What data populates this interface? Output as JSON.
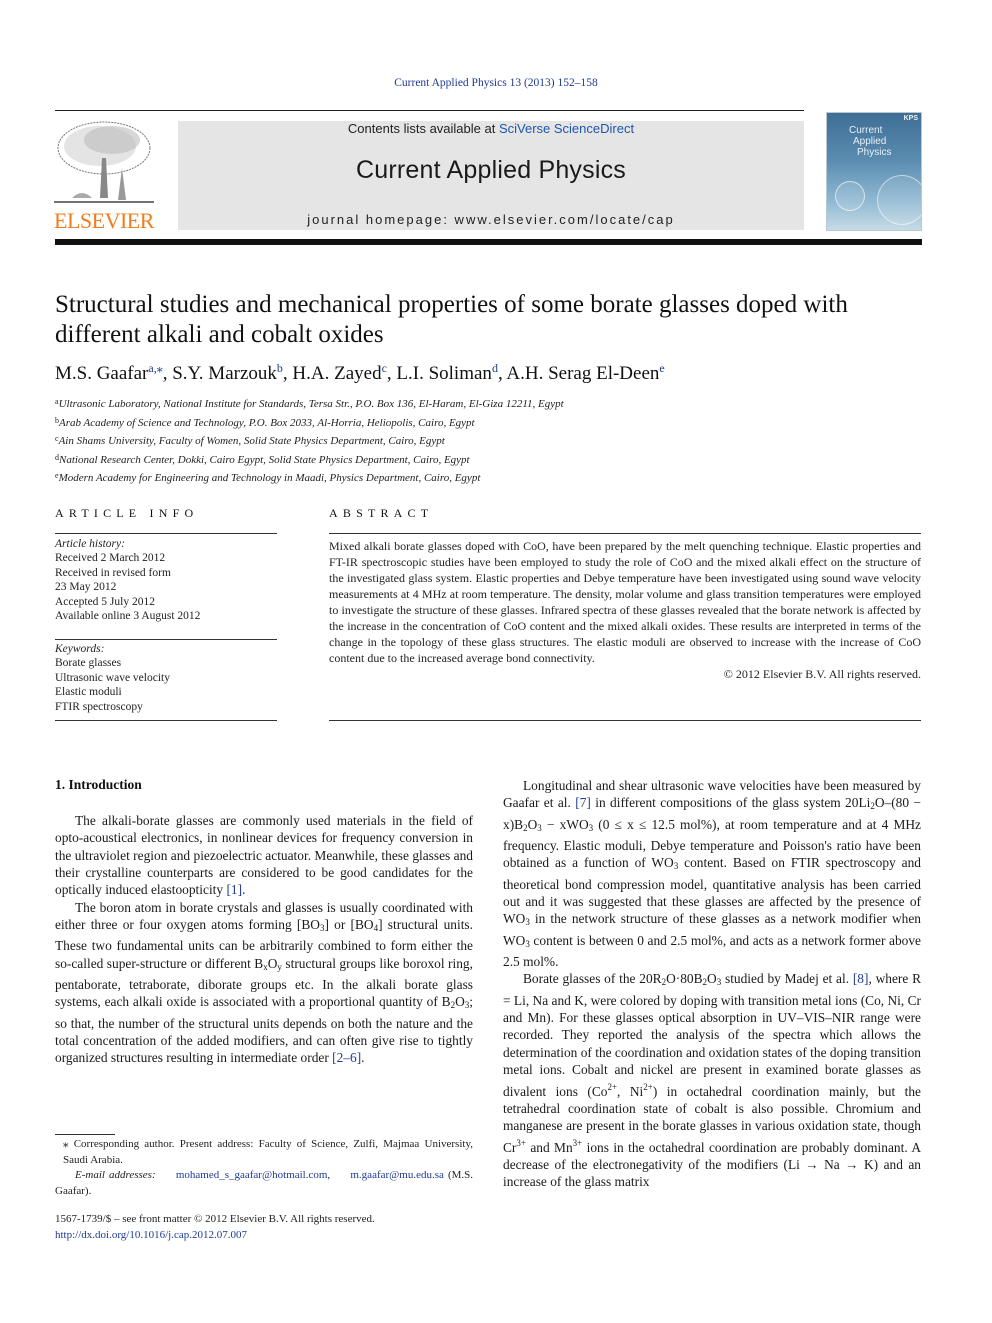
{
  "running_head": "Current Applied Physics 13 (2013) 152–158",
  "masthead": {
    "publisher": "ELSEVIER",
    "contents_prefix": "Contents lists available at ",
    "contents_link": "SciVerse ScienceDirect",
    "journal_name": "Current Applied Physics",
    "homepage": "journal homepage: www.elsevier.com/locate/cap",
    "cover_title_lines": [
      "Current",
      "Applied",
      "Physics"
    ],
    "cover_badge": "KPS",
    "colors": {
      "publisher_orange": "#f07d1c",
      "link_blue": "#1f3a93",
      "masthead_grey": "#e5e5e5"
    }
  },
  "article": {
    "title": "Structural studies and mechanical properties of some borate glasses doped with different alkali and cobalt oxides",
    "authors": [
      {
        "name": "M.S. Gaafar",
        "sup": "a,⁎"
      },
      {
        "name": "S.Y. Marzouk",
        "sup": "b"
      },
      {
        "name": "H.A. Zayed",
        "sup": "c"
      },
      {
        "name": "L.I. Soliman",
        "sup": "d"
      },
      {
        "name": "A.H. Serag El-Deen",
        "sup": "e"
      }
    ],
    "affiliations": [
      {
        "key": "a",
        "text": "Ultrasonic Laboratory, National Institute for Standards, Tersa Str., P.O. Box 136, El-Haram, El-Giza 12211, Egypt"
      },
      {
        "key": "b",
        "text": "Arab Academy of Science and Technology, P.O. Box 2033, Al-Horria, Heliopolis, Cairo, Egypt"
      },
      {
        "key": "c",
        "text": "Ain Shams University, Faculty of Women, Solid State Physics Department, Cairo, Egypt"
      },
      {
        "key": "d",
        "text": "National Research Center, Dokki, Cairo Egypt, Solid State Physics Department, Cairo, Egypt"
      },
      {
        "key": "e",
        "text": "Modern Academy for Engineering and Technology in Maadi, Physics Department, Cairo, Egypt"
      }
    ]
  },
  "article_info": {
    "heading": "ARTICLE INFO",
    "history_label": "Article history:",
    "history": [
      "Received 2 March 2012",
      "Received in revised form",
      "23 May 2012",
      "Accepted 5 July 2012",
      "Available online 3 August 2012"
    ],
    "keywords_label": "Keywords:",
    "keywords": [
      "Borate glasses",
      "Ultrasonic wave velocity",
      "Elastic moduli",
      "FTIR spectroscopy"
    ]
  },
  "abstract": {
    "heading": "ABSTRACT",
    "text": "Mixed alkali borate glasses doped with CoO, have been prepared by the melt quenching technique. Elastic properties and FT-IR spectroscopic studies have been employed to study the role of CoO and the mixed alkali effect on the structure of the investigated glass system. Elastic properties and Debye temperature have been investigated using sound wave velocity measurements at 4 MHz at room temperature. The density, molar volume and glass transition temperatures were employed to investigate the structure of these glasses. Infrared spectra of these glasses revealed that the borate network is affected by the increase in the concentration of CoO content and the mixed alkali oxides. These results are interpreted in terms of the change in the topology of these glass structures. The elastic moduli are observed to increase with the increase of CoO content due to the increased average bond connectivity.",
    "copyright": "© 2012 Elsevier B.V. All rights reserved."
  },
  "body": {
    "section_heading": "1.  Introduction",
    "left": {
      "p1": "The alkali-borate glasses are commonly used materials in the field of opto-acoustical electronics, in nonlinear devices for frequency conversion in the ultraviolet region and piezoelectric actuator. Meanwhile, these glasses and their crystalline counterparts are considered to be good candidates for the optically induced elastoopticity ",
      "p1_ref": "[1]",
      "p2_a": "The boron atom in borate crystals and glasses is usually coordinated with either three or four oxygen atoms forming [BO",
      "p2_b": "] or [BO",
      "p2_c": "] structural units. These two fundamental units can be arbitrarily combined to form either the so-called super-structure or different B",
      "p2_d": "O",
      "p2_e": " structural groups like boroxol ring, pentaborate, tetraborate, diborate groups etc. In the alkali borate glass systems, each alkali oxide is associated with a proportional quantity of B",
      "p2_f": "O",
      "p2_g": "; so that, the number of the structural units depends on both the nature and the total concentration of the added modifiers, and can often give rise to tightly organized structures resulting in intermediate order ",
      "p2_ref": "[2–6]"
    },
    "right": {
      "p1_a": "Longitudinal and shear ultrasonic wave velocities have been measured by Gaafar et al. ",
      "p1_ref": "[7]",
      "p1_b": " in different compositions of the glass system 20Li",
      "p1_c": "O–(80 − x)B",
      "p1_d": "O",
      "p1_e": " − xWO",
      "p1_f": " (0 ≤ x ≤ 12.5 mol%), at room temperature and at 4 MHz frequency. Elastic moduli, Debye temperature and Poisson's ratio have been obtained as a function of WO",
      "p1_g": " content. Based on FTIR spectroscopy and theoretical bond compression model, quantitative analysis has been carried out and it was suggested that these glasses are affected by the presence of WO",
      "p1_h": " in the network structure of these glasses as a network modifier when WO",
      "p1_i": " content is between 0 and 2.5 mol%, and acts as a network former above 2.5 mol%.",
      "p2_a": "Borate glasses of the 20R",
      "p2_b": "O·80B",
      "p2_c": "O",
      "p2_d": " studied by Madej et al. ",
      "p2_ref": "[8]",
      "p2_e": ", where R = Li, Na and K, were colored by doping with transition metal ions (Co, Ni, Cr and Mn). For these glasses optical absorption in UV–VIS–NIR range were recorded. They reported the analysis of the spectra which allows the determination of the coordination and oxidation states of the doping transition metal ions. Cobalt and nickel are present in examined borate glasses as divalent ions (Co",
      "p2_f": ", Ni",
      "p2_g": ") in octahedral coordination mainly, but the tetrahedral coordination state of cobalt is also possible. Chromium and manganese are present in the borate glasses in various oxidation state, though Cr",
      "p2_h": " and Mn",
      "p2_i": " ions in the octahedral coordination are probably dominant. A decrease of the electronegativity of the modifiers (Li → Na → K) and an increase of the glass matrix"
    },
    "subs": {
      "two": "2",
      "three": "3",
      "four": "4",
      "x": "x",
      "y": "y",
      "two_plus": "2+",
      "three_plus": "3+"
    }
  },
  "footnotes": {
    "corresponding": "⁎ Corresponding author. Present address: Faculty of Science, Zulfi, Majmaa University, Saudi Arabia.",
    "email_label": "E-mail addresses:",
    "email_1": "mohamed_s_gaafar@hotmail.com",
    "email_2": "m.gaafar@mu.edu.sa",
    "email_owner": "(M.S. Gaafar).",
    "issn_line": "1567-1739/$ – see front matter © 2012 Elsevier B.V. All rights reserved.",
    "doi": "http://dx.doi.org/10.1016/j.cap.2012.07.007"
  }
}
